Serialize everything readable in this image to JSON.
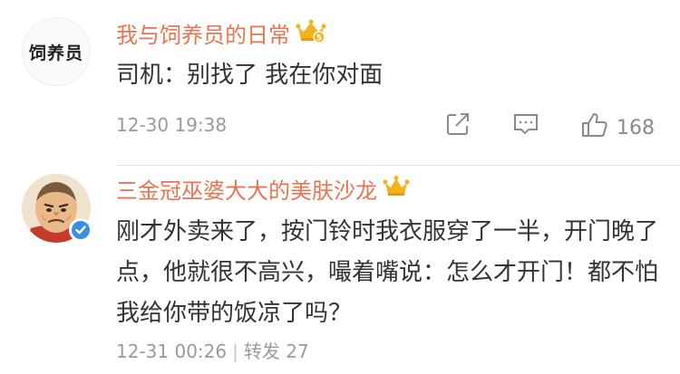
{
  "comments": [
    {
      "avatar_text": "饲养员",
      "name": "我与饲养员的日常",
      "text": "司机：别找了 我在你对面",
      "time": "12-30 19:38",
      "likes": "168",
      "crown_badge": "5"
    },
    {
      "name": "三金冠巫婆大大的美肤沙龙",
      "text": "刚才外卖来了，按门铃时我衣服穿了一半，开门晚了点，他就很不高兴，嘬着嘴说：怎么才开门！都不怕我给你带的饭凉了吗？",
      "time": "12-31 00:26",
      "separator": "|",
      "repost_label": "转发",
      "repost_count": "27"
    }
  ],
  "colors": {
    "name": "#eb7350",
    "text": "#333333",
    "meta": "#9a9a9a",
    "crown": "#f6b21b",
    "verified": "#3a8ee6"
  },
  "icons": [
    "crown-icon",
    "repost-icon",
    "comment-icon",
    "like-icon",
    "verified-icon"
  ]
}
